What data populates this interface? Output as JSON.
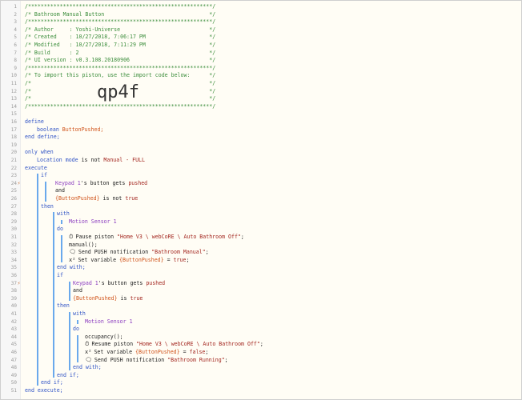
{
  "editor": {
    "header_lines": [
      "/**********************************************************/",
      "/* Bathroom Manual Button                                 */",
      "/**********************************************************/",
      "/* Author     : Yoshi-Universe                            */",
      "/* Created    : 10/27/2018, 7:06:17 PM                    */",
      "/* Modified   : 10/27/2018, 7:11:29 PM                    */",
      "/* Build      : 2                                         */",
      "/* UI version : v0.3.108.20180906                         */",
      "/**********************************************************/",
      "/* To import this piston, use the import code below:      */",
      "/*                                                        */",
      "/*                                                        */",
      "/*                                                        */",
      "/**********************************************************/"
    ],
    "import_code": "qp4f",
    "line_numbers": [
      "1",
      "2",
      "3",
      "4",
      "5",
      "6",
      "7",
      "8",
      "9",
      "10",
      "11",
      "12",
      "13",
      "14",
      "15",
      "16",
      "17",
      "18",
      "19",
      "20",
      "21",
      "22",
      "23",
      "24",
      "25",
      "26",
      "27",
      "28",
      "29",
      "30",
      "31",
      "32",
      "33",
      "34",
      "35",
      "36",
      "37",
      "38",
      "39",
      "40",
      "41",
      "42",
      "43",
      "44",
      "45",
      "46",
      "47",
      "48",
      "49",
      "50",
      "51"
    ],
    "breakpoint_mark": "⚡",
    "code": {
      "l16": "define",
      "l17_type": "boolean",
      "l17_var": "ButtonPushed;",
      "l18": "end define;",
      "l20": "only when",
      "l21_a": "Location mode",
      "l21_b": " is not ",
      "l21_c": "Manual - FULL",
      "l22": "execute",
      "l23": "if",
      "l24_dev": "Keypad 1",
      "l24_rest": "'s button gets ",
      "l24_val": "pushed",
      "l25": "and",
      "l26_var": "{ButtonPushed}",
      "l26_rest": " is not ",
      "l26_val": "true",
      "l27": "then",
      "l28": "with",
      "l29": "Motion Sensor 1",
      "l30": "do",
      "l31_a": "Pause piston ",
      "l31_b": "\"Home V3 \\ webCoRE \\ Auto Bathroom Off\"",
      "l31_c": ";",
      "l32": "manual();",
      "l33_a": "Send PUSH notification ",
      "l33_b": "\"Bathroom Manual\"",
      "l33_c": ";",
      "l34_a": "Set variable ",
      "l34_b": "{ButtonPushed}",
      "l34_c": " = ",
      "l34_d": "true",
      "l34_e": ";",
      "l35": "end with;",
      "l36": "if",
      "l37_dev": "Keypad 1",
      "l37_rest": "'s button gets ",
      "l37_val": "pushed",
      "l38": "and",
      "l39_var": "{ButtonPushed}",
      "l39_rest": " is ",
      "l39_val": "true",
      "l40": "then",
      "l41": "with",
      "l42": "Motion Sensor 1",
      "l43": "do",
      "l44": "occupancy();",
      "l45_a": "Resume piston ",
      "l45_b": "\"Home V3 \\ webCoRE \\ Auto Bathroom Off\"",
      "l45_c": ";",
      "l46_a": "Set variable ",
      "l46_b": "{ButtonPushed}",
      "l46_c": " = ",
      "l46_d": "false",
      "l46_e": ";",
      "l47_a": "Send PUSH notification ",
      "l47_b": "\"Bathroom Running\"",
      "l47_c": ";",
      "l48": "end with;",
      "l49": "end if;",
      "l50": "end if;",
      "l51": "end execute;"
    },
    "icons": {
      "clock": "⏱",
      "chat": "🗨",
      "var": "x²"
    },
    "colors": {
      "comment": "#3b8d3b",
      "keyword": "#2f52c5",
      "variable": "#d1541b",
      "device": "#8b3dbf",
      "string": "#a3261f",
      "guide": "#6aa9ec"
    }
  }
}
